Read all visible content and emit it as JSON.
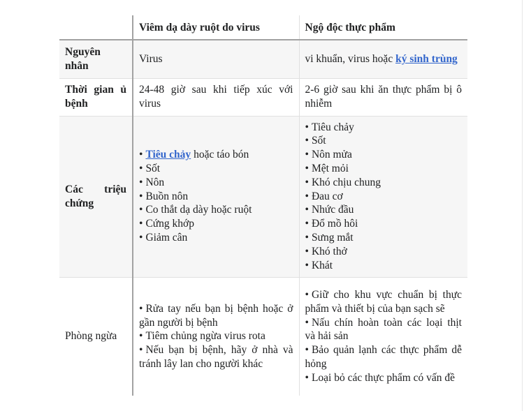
{
  "table": {
    "headers": [
      "",
      "Viêm dạ dày ruột do virus",
      "Ngộ độc thực phẩm"
    ],
    "rows": {
      "cause": {
        "label": "Nguyên nhân",
        "viral": "Virus",
        "food_prefix": "vi khuẩn, virus hoặc ",
        "food_link": "ký sinh trùng"
      },
      "incubation": {
        "label": "Thời gian ủ bệnh",
        "viral": "24-48 giờ sau khi tiếp xúc với virus",
        "food": "2-6 giờ sau khi ăn thực phẩm bị ô nhiễm"
      },
      "symptoms": {
        "label": "Các triệu chứng",
        "viral_first_link": "Tiêu chảy",
        "viral_first_rest": " hoặc táo bón",
        "viral": [
          "Sốt",
          "Nôn",
          "Buồn nôn",
          "Co thắt dạ dày hoặc ruột",
          "Cứng khớp",
          "Giảm cân"
        ],
        "food": [
          "Tiêu chảy",
          "Sốt",
          "Nôn mửa",
          "Mệt mỏi",
          "Khó chịu chung",
          "Đau cơ",
          "Nhức đầu",
          "Đổ mồ hôi",
          "Sưng mắt",
          "Khó thở",
          "Khát"
        ]
      },
      "prevention": {
        "label": "Phòng ngừa",
        "viral": [
          "Rửa tay nếu bạn bị bệnh hoặc ở gần người bị bệnh",
          "Tiêm chủng ngừa virus rota",
          "Nếu bạn bị bệnh, hãy ở nhà và tránh lây lan cho người khác"
        ],
        "food": [
          "Giữ cho khu vực chuẩn bị thực phẩm và thiết bị của bạn sạch sẽ",
          "Nấu chín hoàn toàn các loại thịt và hải sản",
          "Bảo quản lạnh các thực phẩm dễ hỏng",
          "Loại bỏ các thực phẩm có vấn đề"
        ]
      }
    },
    "bullet": "•"
  },
  "colors": {
    "link": "#3366cc",
    "row_alt_bg": "#f6f6f6",
    "strong_border": "#a2a2a2",
    "light_border": "#e0e0e0"
  }
}
